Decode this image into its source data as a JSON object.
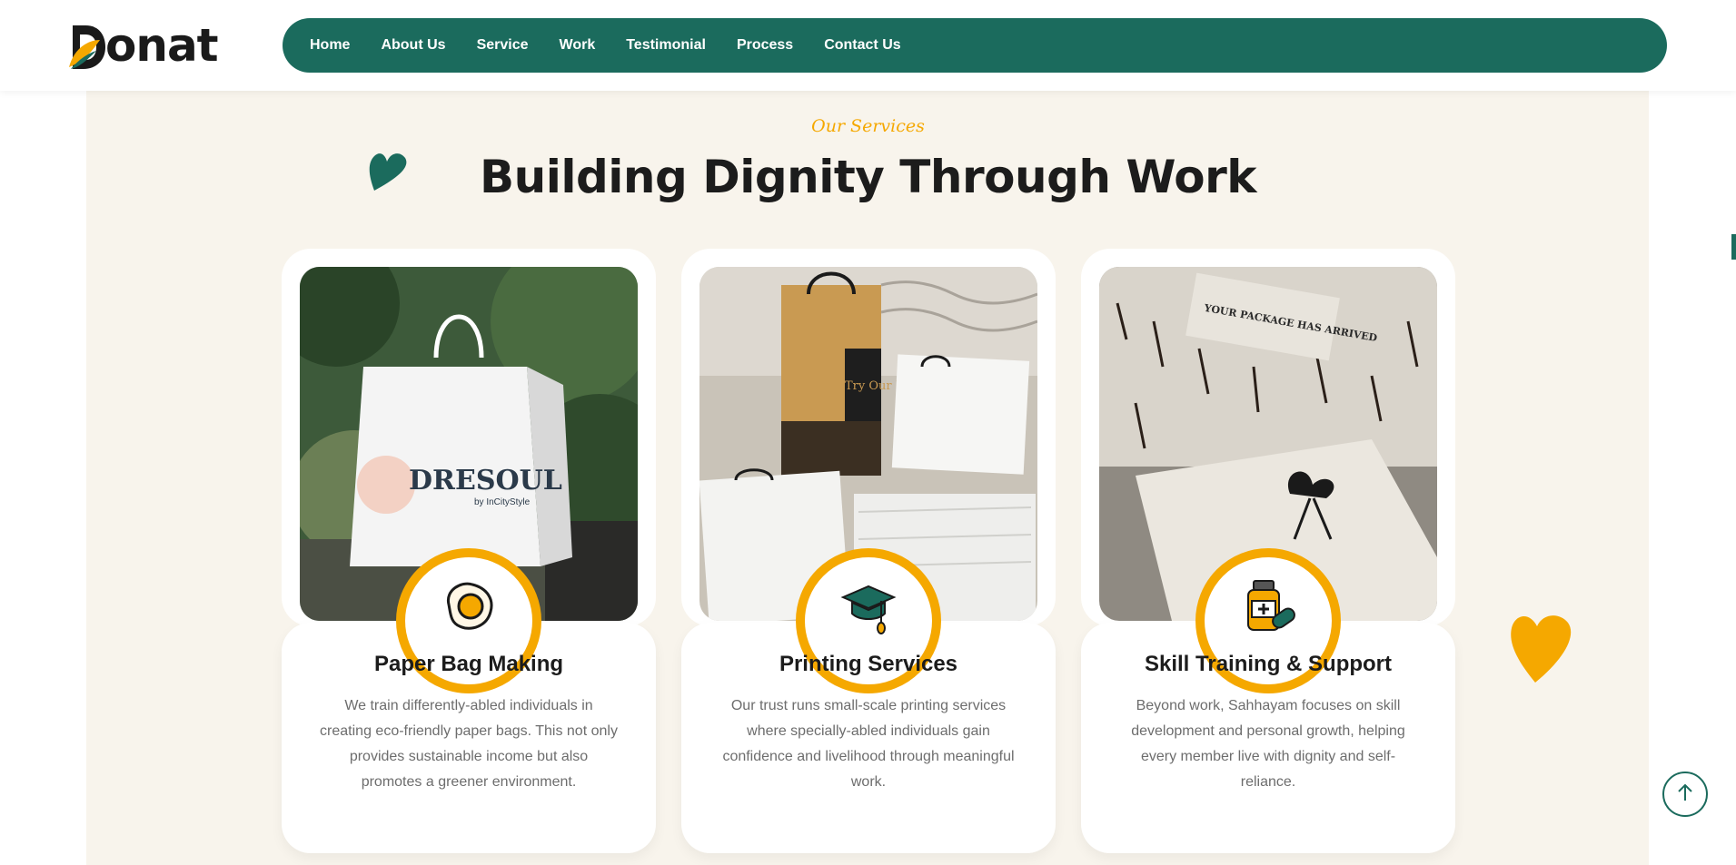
{
  "brand": {
    "name": "onat",
    "colors": {
      "primary": "#1b6b5d",
      "accent": "#f5a800"
    }
  },
  "nav": {
    "items": [
      {
        "label": "Home"
      },
      {
        "label": "About Us"
      },
      {
        "label": "Service"
      },
      {
        "label": "Work"
      },
      {
        "label": "Testimonial"
      },
      {
        "label": "Process"
      },
      {
        "label": "Contact Us"
      }
    ]
  },
  "section": {
    "eyebrow": "Our Services",
    "title": "Building Dignity Through Work"
  },
  "cards": [
    {
      "title": "Paper Bag Making",
      "text": "We train differently-abled individuals in creating eco-friendly paper bags. This not only provides sustainable income but also promotes a greener environment.",
      "icon": "fried-egg-icon",
      "image_text": "DRESOUL",
      "image_subtext": "by InCityStyle"
    },
    {
      "title": "Printing Services",
      "text": "Our trust runs small-scale printing services where specially-abled individuals gain confidence and livelihood through meaningful work.",
      "icon": "graduation-cap-icon",
      "image_text": "Try Our Bakes"
    },
    {
      "title": "Skill Training & Support",
      "text": "Beyond work, Sahhayam focuses on skill development and personal growth, helping every member live with dignity and self-reliance.",
      "icon": "medicine-bottle-icon",
      "image_text": "YOUR PACKAGE HAS ARRIVED"
    }
  ],
  "scroll_top": {
    "icon": "arrow-up-icon"
  }
}
